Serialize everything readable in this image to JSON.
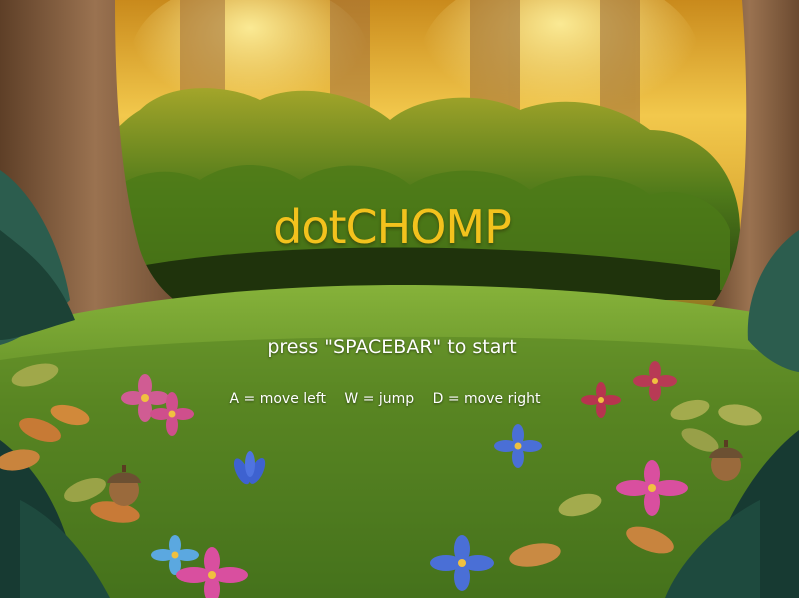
{
  "game": {
    "title": "dotCHOMP",
    "start_prompt": "press \"SPACEBAR\" to start",
    "controls": [
      {
        "label": "A = move left"
      },
      {
        "label": "W = jump"
      },
      {
        "label": "D = move right"
      }
    ]
  },
  "colors": {
    "title": "#f3c21d",
    "sky_glow": "#ffd24a",
    "grass": "#5e8a23",
    "tree_trunk": "#8a6240",
    "bush": "#3f6a16",
    "fern": "#1f4a3a",
    "text": "#ffffff"
  },
  "sprites": {
    "decor": [
      "tree-trunk-icon",
      "bush-icon",
      "fern-icon",
      "flower-icon",
      "acorn-icon",
      "leaf-icon"
    ]
  }
}
